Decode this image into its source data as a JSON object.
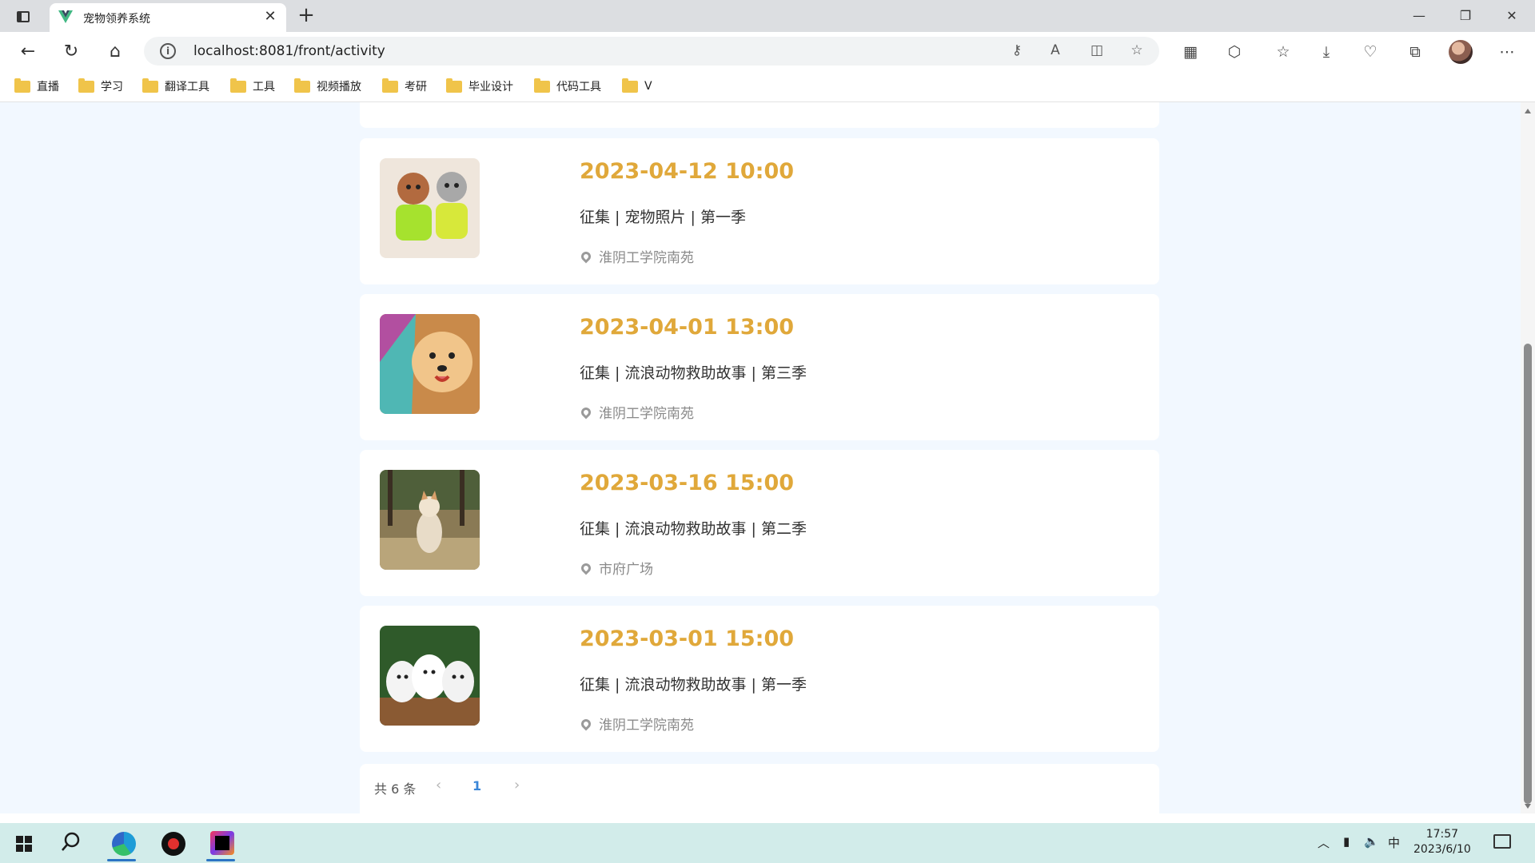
{
  "browser": {
    "tab": {
      "title": "宠物领养系统"
    },
    "address": {
      "url": "localhost:8081/front/activity"
    },
    "bookmarks": [
      "直播",
      "学习",
      "翻译工具",
      "工具",
      "视频播放",
      "考研",
      "毕业设计",
      "代码工具",
      "V"
    ]
  },
  "activities": [
    {
      "time": "2023-04-12 10:00",
      "title": "征集 | 宠物照片 | 第一季",
      "location": "淮阴工学院南苑",
      "image": "poodle-dogs-photo"
    },
    {
      "time": "2023-04-01 13:00",
      "title": "征集 | 流浪动物救助故事 | 第三季",
      "location": "淮阴工学院南苑",
      "image": "pomeranian-photo"
    },
    {
      "time": "2023-03-16 15:00",
      "title": "征集 | 流浪动物救助故事 | 第二季",
      "location": "市府广场",
      "image": "shiba-dog-photo"
    },
    {
      "time": "2023-03-01 15:00",
      "title": "征集 | 流浪动物救助故事 | 第一季",
      "location": "淮阴工学院南苑",
      "image": "white-puppies-photo"
    }
  ],
  "pagination": {
    "total_text": "共 6 条",
    "current_page": "1",
    "prev_icon": "chevron-left-icon",
    "next_icon": "chevron-right-icon"
  },
  "taskbar": {
    "ime": "中",
    "time": "17:57",
    "date": "2023/6/10"
  },
  "colors": {
    "accent_time": "#e0a83a",
    "page_bg": "#f2f8ff",
    "page_link": "#3a86d8"
  }
}
